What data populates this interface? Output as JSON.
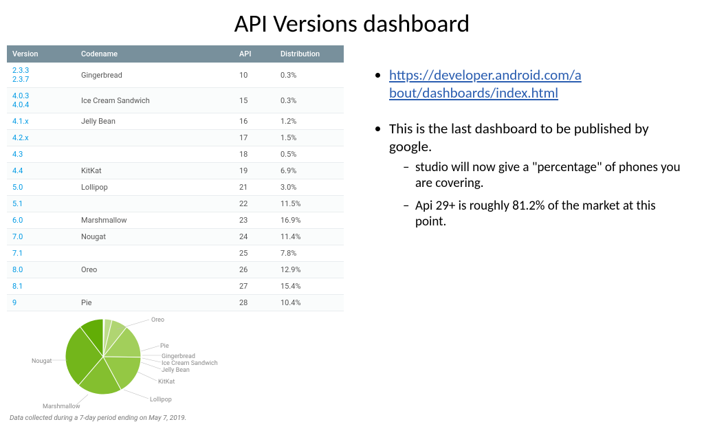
{
  "title": "API Versions dashboard",
  "link_url": "https://developer.android.com/about/dashboards/index.html",
  "link_text_line1": "https://developer.android.com/a",
  "link_text_line2": "bout/dashboards/index.html",
  "bullet_last": "This is the last dashboard to be published by google.",
  "sub1": "studio will now give a \"percentage\" of phones you are covering.",
  "sub2": "Api 29+  is roughly 81.2% of the market at this point.",
  "table": {
    "headers": {
      "version": "Version",
      "codename": "Codename",
      "api": "API",
      "distribution": "Distribution"
    },
    "rows": [
      {
        "version": "2.3.3 - 2.3.7",
        "codename": "Gingerbread",
        "api": "10",
        "dist": "0.3%"
      },
      {
        "version": "4.0.3 - 4.0.4",
        "codename": "Ice Cream Sandwich",
        "api": "15",
        "dist": "0.3%"
      },
      {
        "version": "4.1.x",
        "codename": "Jelly Bean",
        "api": "16",
        "dist": "1.2%"
      },
      {
        "version": "4.2.x",
        "codename": "",
        "api": "17",
        "dist": "1.5%"
      },
      {
        "version": "4.3",
        "codename": "",
        "api": "18",
        "dist": "0.5%"
      },
      {
        "version": "4.4",
        "codename": "KitKat",
        "api": "19",
        "dist": "6.9%"
      },
      {
        "version": "5.0",
        "codename": "Lollipop",
        "api": "21",
        "dist": "3.0%"
      },
      {
        "version": "5.1",
        "codename": "",
        "api": "22",
        "dist": "11.5%"
      },
      {
        "version": "6.0",
        "codename": "Marshmallow",
        "api": "23",
        "dist": "16.9%"
      },
      {
        "version": "7.0",
        "codename": "Nougat",
        "api": "24",
        "dist": "11.4%"
      },
      {
        "version": "7.1",
        "codename": "",
        "api": "25",
        "dist": "7.8%"
      },
      {
        "version": "8.0",
        "codename": "Oreo",
        "api": "26",
        "dist": "12.9%"
      },
      {
        "version": "8.1",
        "codename": "",
        "api": "27",
        "dist": "15.4%"
      },
      {
        "version": "9",
        "codename": "Pie",
        "api": "28",
        "dist": "10.4%"
      }
    ]
  },
  "pie_labels": {
    "oreo": "Oreo",
    "pie": "Pie",
    "gingerbread": "Gingerbread",
    "ics": "Ice Cream Sandwich",
    "jellybean": "Jelly Bean",
    "kitkat": "KitKat",
    "lollipop": "Lollipop",
    "marshmallow": "Marshmallow",
    "nougat": "Nougat"
  },
  "footnote": "Data collected during a 7-day period ending on May 7, 2019.",
  "chart_data": {
    "type": "pie",
    "title": "",
    "series": [
      {
        "name": "Gingerbread",
        "value": 0.3
      },
      {
        "name": "Ice Cream Sandwich",
        "value": 0.3
      },
      {
        "name": "Jelly Bean",
        "value": 3.2
      },
      {
        "name": "KitKat",
        "value": 6.9
      },
      {
        "name": "Lollipop",
        "value": 14.5
      },
      {
        "name": "Marshmallow",
        "value": 16.9
      },
      {
        "name": "Nougat",
        "value": 19.2
      },
      {
        "name": "Oreo",
        "value": 28.3
      },
      {
        "name": "Pie",
        "value": 10.4
      }
    ]
  }
}
